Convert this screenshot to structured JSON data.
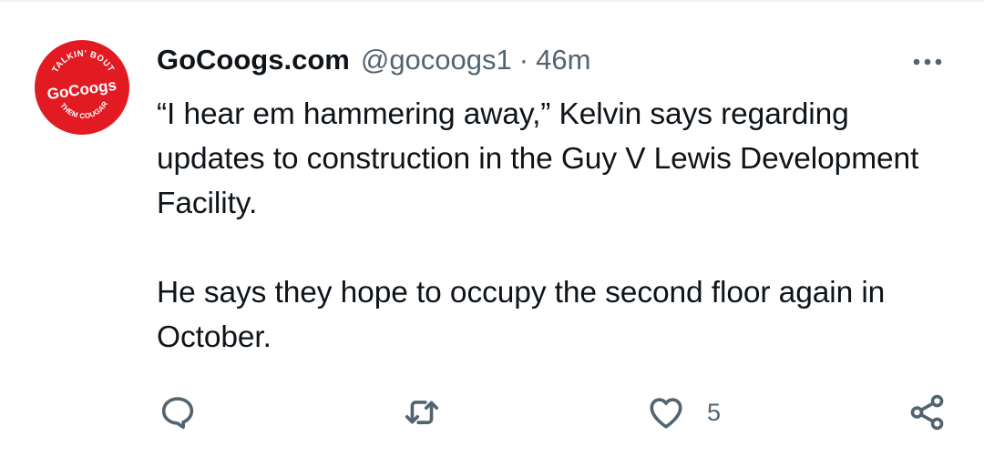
{
  "tweet": {
    "author": {
      "display_name": "GoCoogs.com",
      "handle": "@gocoogs1",
      "avatar_top_text": "TALKIN' BOUT",
      "avatar_main_text": "GoCoogs",
      "avatar_bottom_text": "THEM COUGARS!"
    },
    "separator": "·",
    "time": "46m",
    "paragraphs": [
      "“I hear em hammering away,” Kelvin says regarding updates to construction in the Guy V Lewis Development Facility.",
      "He says they hope to occupy the second floor again in October."
    ],
    "actions": {
      "reply_icon": "reply-icon",
      "retweet_icon": "retweet-icon",
      "like_icon": "heart-icon",
      "like_count": "5",
      "share_icon": "share-icon",
      "more_icon": "more-icon"
    },
    "colors": {
      "text": "#0f1419",
      "secondary": "#536471",
      "avatar_bg": "#e21b23"
    }
  }
}
